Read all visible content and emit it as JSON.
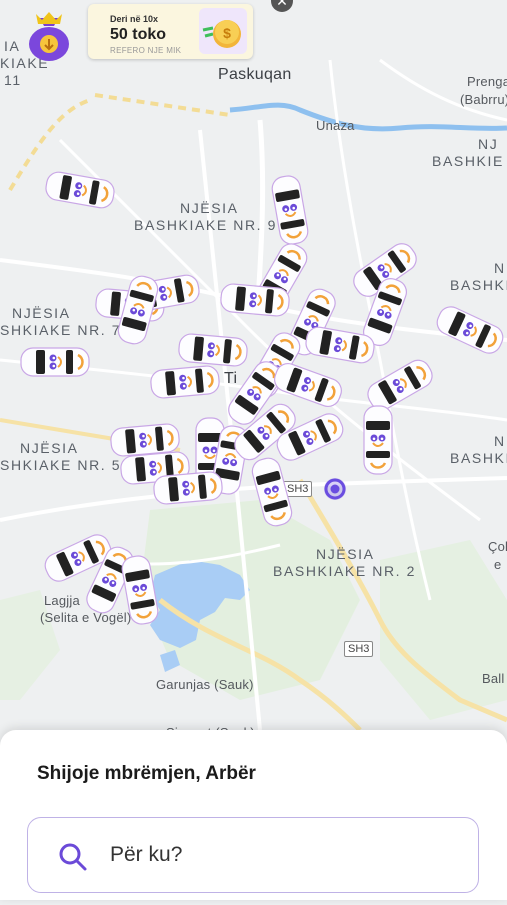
{
  "promo": {
    "line1": "Deri në 10x",
    "line2": "50 toko",
    "line3": "REFERO NJE MIK",
    "close": "✕"
  },
  "map": {
    "labels": {
      "paskuqan": "Paskuqan",
      "unaza": "Unaza",
      "prenga": "Prenga",
      "babrru": "(Babrru)",
      "nr9_line1": "NJËSIA",
      "nr9_line2": "BASHKIAKE NR. 9",
      "nr7_line1": "NJËSIA",
      "nr7_line2": "SHKIAKE NR. 7",
      "nr5_line1": "NJËSIA",
      "nr5_line2": "SHKIAKE NR. 5",
      "nr2_line1": "NJËSIA",
      "nr2_line2": "BASHKIAKE NR. 2",
      "right_nj": "NJ",
      "right_bashkie": "BASHKIE",
      "right_n1": "N",
      "right_bashki1": "BASHKI",
      "right_n2": "N",
      "right_bashki2": "BASHKI",
      "left_top1": "IA",
      "left_top2": "KIAKE",
      "left_top3": "11",
      "lagjja": "Lagjja",
      "selita": "(Selita e Vogël)",
      "garunjas": "Garunjas (Sauk)",
      "sinapet": "Sinapet (Sauk)",
      "col": "Çol",
      "ball": "Ball",
      "e": "e",
      "ti": "Ti",
      "sh3_a": "SH3",
      "sh3_b": "SH3"
    }
  },
  "sheet": {
    "greeting": "Shijoje mbrëmjen, Arbër",
    "search_placeholder": "Për ku?"
  },
  "colors": {
    "accent": "#6b4ad8",
    "location": "#6a4de0",
    "water": "#a9cdf5",
    "river": "#8ec0ef",
    "road_yellow": "#f6e2a6",
    "park": "#dfeedd"
  }
}
